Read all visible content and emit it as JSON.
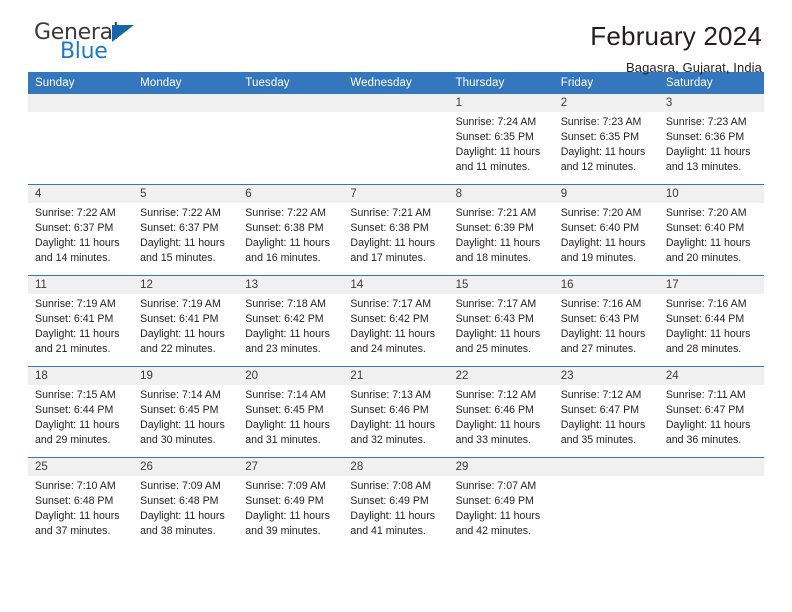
{
  "brand": {
    "name_part1": "General",
    "name_part2": "Blue"
  },
  "header": {
    "title": "February 2024",
    "location": "Bagasra, Gujarat, India"
  },
  "colors": {
    "header_blue": "#3577bd",
    "logo_blue": "#1f7ac4",
    "daynum_band": "#f0f0f0"
  },
  "weekdays": [
    "Sunday",
    "Monday",
    "Tuesday",
    "Wednesday",
    "Thursday",
    "Friday",
    "Saturday"
  ],
  "weeks": [
    [
      {
        "day": "",
        "sunrise": "",
        "sunset": "",
        "daylight": ""
      },
      {
        "day": "",
        "sunrise": "",
        "sunset": "",
        "daylight": ""
      },
      {
        "day": "",
        "sunrise": "",
        "sunset": "",
        "daylight": ""
      },
      {
        "day": "",
        "sunrise": "",
        "sunset": "",
        "daylight": ""
      },
      {
        "day": "1",
        "sunrise": "Sunrise: 7:24 AM",
        "sunset": "Sunset: 6:35 PM",
        "daylight": "Daylight: 11 hours and 11 minutes."
      },
      {
        "day": "2",
        "sunrise": "Sunrise: 7:23 AM",
        "sunset": "Sunset: 6:35 PM",
        "daylight": "Daylight: 11 hours and 12 minutes."
      },
      {
        "day": "3",
        "sunrise": "Sunrise: 7:23 AM",
        "sunset": "Sunset: 6:36 PM",
        "daylight": "Daylight: 11 hours and 13 minutes."
      }
    ],
    [
      {
        "day": "4",
        "sunrise": "Sunrise: 7:22 AM",
        "sunset": "Sunset: 6:37 PM",
        "daylight": "Daylight: 11 hours and 14 minutes."
      },
      {
        "day": "5",
        "sunrise": "Sunrise: 7:22 AM",
        "sunset": "Sunset: 6:37 PM",
        "daylight": "Daylight: 11 hours and 15 minutes."
      },
      {
        "day": "6",
        "sunrise": "Sunrise: 7:22 AM",
        "sunset": "Sunset: 6:38 PM",
        "daylight": "Daylight: 11 hours and 16 minutes."
      },
      {
        "day": "7",
        "sunrise": "Sunrise: 7:21 AM",
        "sunset": "Sunset: 6:38 PM",
        "daylight": "Daylight: 11 hours and 17 minutes."
      },
      {
        "day": "8",
        "sunrise": "Sunrise: 7:21 AM",
        "sunset": "Sunset: 6:39 PM",
        "daylight": "Daylight: 11 hours and 18 minutes."
      },
      {
        "day": "9",
        "sunrise": "Sunrise: 7:20 AM",
        "sunset": "Sunset: 6:40 PM",
        "daylight": "Daylight: 11 hours and 19 minutes."
      },
      {
        "day": "10",
        "sunrise": "Sunrise: 7:20 AM",
        "sunset": "Sunset: 6:40 PM",
        "daylight": "Daylight: 11 hours and 20 minutes."
      }
    ],
    [
      {
        "day": "11",
        "sunrise": "Sunrise: 7:19 AM",
        "sunset": "Sunset: 6:41 PM",
        "daylight": "Daylight: 11 hours and 21 minutes."
      },
      {
        "day": "12",
        "sunrise": "Sunrise: 7:19 AM",
        "sunset": "Sunset: 6:41 PM",
        "daylight": "Daylight: 11 hours and 22 minutes."
      },
      {
        "day": "13",
        "sunrise": "Sunrise: 7:18 AM",
        "sunset": "Sunset: 6:42 PM",
        "daylight": "Daylight: 11 hours and 23 minutes."
      },
      {
        "day": "14",
        "sunrise": "Sunrise: 7:17 AM",
        "sunset": "Sunset: 6:42 PM",
        "daylight": "Daylight: 11 hours and 24 minutes."
      },
      {
        "day": "15",
        "sunrise": "Sunrise: 7:17 AM",
        "sunset": "Sunset: 6:43 PM",
        "daylight": "Daylight: 11 hours and 25 minutes."
      },
      {
        "day": "16",
        "sunrise": "Sunrise: 7:16 AM",
        "sunset": "Sunset: 6:43 PM",
        "daylight": "Daylight: 11 hours and 27 minutes."
      },
      {
        "day": "17",
        "sunrise": "Sunrise: 7:16 AM",
        "sunset": "Sunset: 6:44 PM",
        "daylight": "Daylight: 11 hours and 28 minutes."
      }
    ],
    [
      {
        "day": "18",
        "sunrise": "Sunrise: 7:15 AM",
        "sunset": "Sunset: 6:44 PM",
        "daylight": "Daylight: 11 hours and 29 minutes."
      },
      {
        "day": "19",
        "sunrise": "Sunrise: 7:14 AM",
        "sunset": "Sunset: 6:45 PM",
        "daylight": "Daylight: 11 hours and 30 minutes."
      },
      {
        "day": "20",
        "sunrise": "Sunrise: 7:14 AM",
        "sunset": "Sunset: 6:45 PM",
        "daylight": "Daylight: 11 hours and 31 minutes."
      },
      {
        "day": "21",
        "sunrise": "Sunrise: 7:13 AM",
        "sunset": "Sunset: 6:46 PM",
        "daylight": "Daylight: 11 hours and 32 minutes."
      },
      {
        "day": "22",
        "sunrise": "Sunrise: 7:12 AM",
        "sunset": "Sunset: 6:46 PM",
        "daylight": "Daylight: 11 hours and 33 minutes."
      },
      {
        "day": "23",
        "sunrise": "Sunrise: 7:12 AM",
        "sunset": "Sunset: 6:47 PM",
        "daylight": "Daylight: 11 hours and 35 minutes."
      },
      {
        "day": "24",
        "sunrise": "Sunrise: 7:11 AM",
        "sunset": "Sunset: 6:47 PM",
        "daylight": "Daylight: 11 hours and 36 minutes."
      }
    ],
    [
      {
        "day": "25",
        "sunrise": "Sunrise: 7:10 AM",
        "sunset": "Sunset: 6:48 PM",
        "daylight": "Daylight: 11 hours and 37 minutes."
      },
      {
        "day": "26",
        "sunrise": "Sunrise: 7:09 AM",
        "sunset": "Sunset: 6:48 PM",
        "daylight": "Daylight: 11 hours and 38 minutes."
      },
      {
        "day": "27",
        "sunrise": "Sunrise: 7:09 AM",
        "sunset": "Sunset: 6:49 PM",
        "daylight": "Daylight: 11 hours and 39 minutes."
      },
      {
        "day": "28",
        "sunrise": "Sunrise: 7:08 AM",
        "sunset": "Sunset: 6:49 PM",
        "daylight": "Daylight: 11 hours and 41 minutes."
      },
      {
        "day": "29",
        "sunrise": "Sunrise: 7:07 AM",
        "sunset": "Sunset: 6:49 PM",
        "daylight": "Daylight: 11 hours and 42 minutes."
      },
      {
        "day": "",
        "sunrise": "",
        "sunset": "",
        "daylight": ""
      },
      {
        "day": "",
        "sunrise": "",
        "sunset": "",
        "daylight": ""
      }
    ]
  ]
}
